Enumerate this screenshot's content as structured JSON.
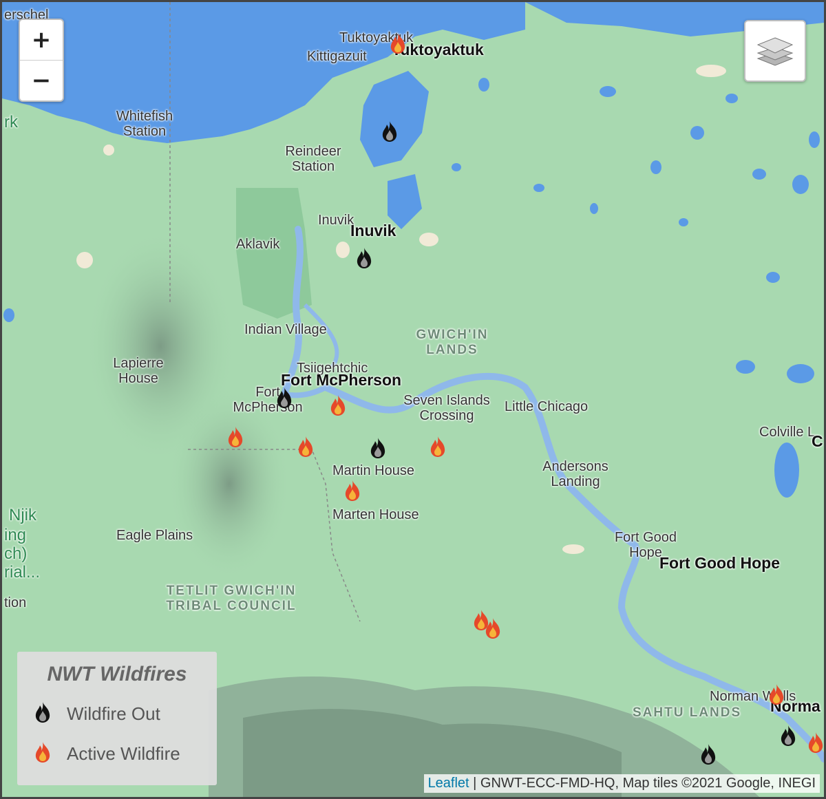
{
  "map": {
    "zoom_in": "+",
    "zoom_out": "−",
    "layers_icon": "layers-icon",
    "colors": {
      "land": "#a8d9b0",
      "water": "#5b9ae6",
      "river": "#8fb8ea",
      "border": "#888888",
      "fire_out": "#111111",
      "fire_active": "#e5492a"
    }
  },
  "legend": {
    "title": "NWT Wildfires",
    "items": [
      {
        "label": "Wildfire Out",
        "icon": "fire-out-icon"
      },
      {
        "label": "Active Wildfire",
        "icon": "fire-active-icon"
      }
    ]
  },
  "attribution": {
    "link": "Leaflet",
    "text": " | GNWT-ECC-FMD-HQ, Map tiles ©2021 Google, INEGI"
  },
  "places": {
    "herschel": "erschel",
    "tuktoyaktuk_small": "Tuktoyaktuk",
    "tuktoyaktuk_big": "Tuktoyaktuk",
    "kittigazuit": "Kittigazuit",
    "ark": "rk",
    "whitefish_1": "Whitefish",
    "whitefish_2": "Station",
    "reindeer_1": "Reindeer",
    "reindeer_2": "Station",
    "inuvik_small": "Inuvik",
    "inuvik_big": "Inuvik",
    "aklavik": "Aklavik",
    "indian_village": "Indian Village",
    "gwichin_1": "GWICH'IN",
    "gwichin_2": "LANDS",
    "lapierre_1": "Lapierre",
    "lapierre_2": "House",
    "tsiigehtchic": "Tsiigehtchic",
    "fort_mcpherson_big": "Fort McPherson",
    "fort_mcp_1": "Fort",
    "fort_mcp_2": "McPherson",
    "seven_1": "Seven Islands",
    "seven_2": "Crossing",
    "little_chicago": "Little Chicago",
    "colville": "Colville L",
    "colville_c": "C",
    "martin_house": "Martin House",
    "andersons_1": "Andersons",
    "andersons_2": "Landing",
    "marten_house": "Marten House",
    "njik_1": "Njik",
    "njik_2": "ing",
    "njik_3": "ch)",
    "njik_4": "rial...",
    "njik_5": "tion",
    "eagle_plains": "Eagle Plains",
    "fort_good_hope_1": "Fort Good",
    "fort_good_hope_2": "Hope",
    "fort_good_hope_big": "Fort Good Hope",
    "tetlit_1": "TETLIT GWICH'IN",
    "tetlit_2": "TRIBAL COUNCIL",
    "norman_wells": "Norman Wells",
    "norman_big": "Norma",
    "sahtu": "SAHTU LANDS"
  }
}
